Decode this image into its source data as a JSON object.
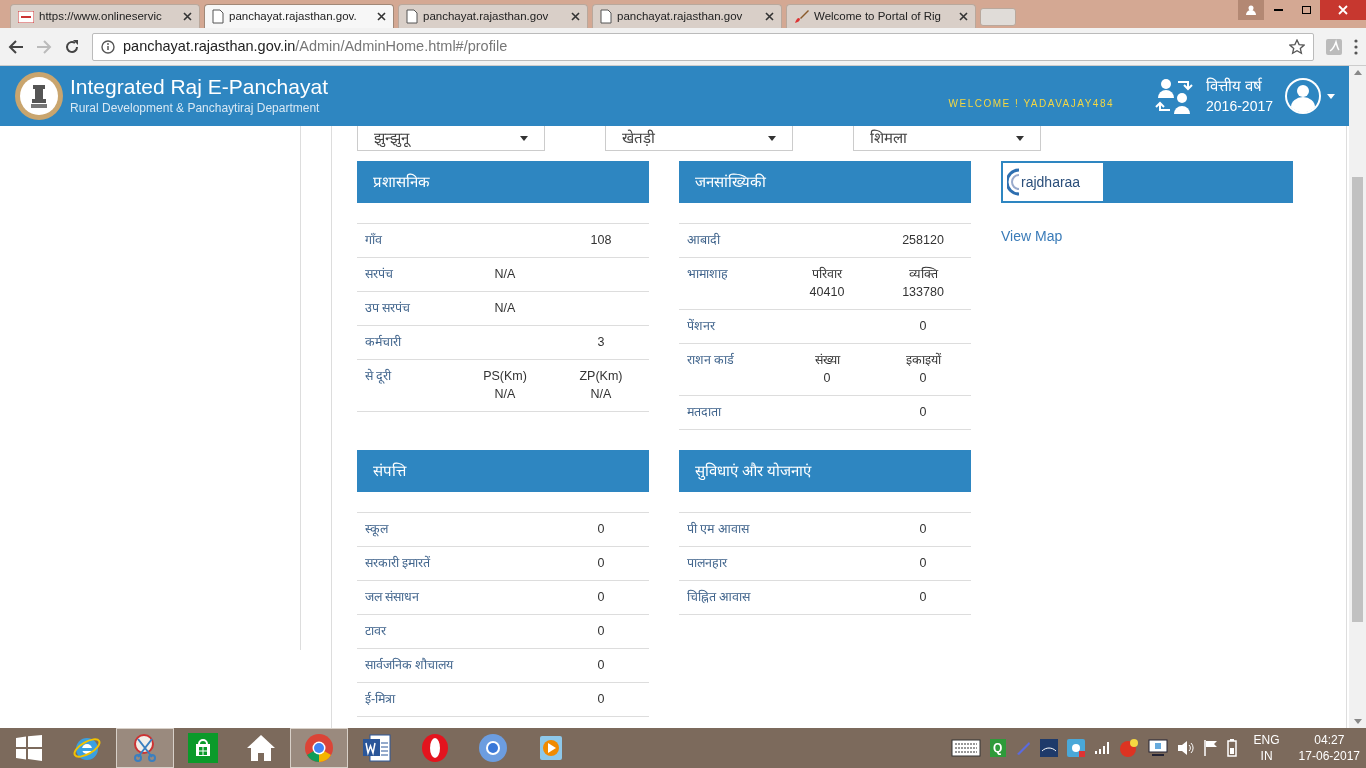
{
  "browser": {
    "tabs": [
      {
        "label": "https://www.onlineservic",
        "selected": false
      },
      {
        "label": "panchayat.rajasthan.gov.",
        "selected": true
      },
      {
        "label": "panchayat.rajasthan.gov",
        "selected": false
      },
      {
        "label": "panchayat.rajasthan.gov",
        "selected": false
      },
      {
        "label": "Welcome to Portal of Rig",
        "selected": false
      }
    ],
    "url_host": "panchayat.rajasthan.gov.in",
    "url_path": "/Admin/AdminHome.html#/profile"
  },
  "header": {
    "title": "Integrated Raj E-Panchayat",
    "subtitle": "Rural Development & Panchaytiraj Department",
    "welcome": "WELCOME ! YADAVAJAY484",
    "year_label": "वित्तीय वर्ष",
    "year": "2016-2017"
  },
  "selects": [
    {
      "value": "झुन्झुनू"
    },
    {
      "value": "खेतड़ी"
    },
    {
      "value": "शिमला"
    }
  ],
  "panels": [
    {
      "title": "प्रशासनिक",
      "rows": [
        {
          "label": "गाँव",
          "right": {
            "value": "108"
          }
        },
        {
          "label": "सरपंच",
          "mid": {
            "value": "N/A"
          }
        },
        {
          "label": "उप सरपंच",
          "mid": {
            "value": "N/A"
          }
        },
        {
          "label": "कर्मचारी",
          "right": {
            "value": "3"
          }
        },
        {
          "label": "से दूरी",
          "mid": {
            "head": "PS(Km)",
            "value": "N/A"
          },
          "right": {
            "head": "ZP(Km)",
            "value": "N/A"
          }
        }
      ]
    },
    {
      "title": "जनसांख्यिकी",
      "rows": [
        {
          "label": "आबादी",
          "right": {
            "value": "258120"
          }
        },
        {
          "label": "भामाशाह",
          "mid": {
            "head": "परिवार",
            "value": "40410"
          },
          "right": {
            "head": "व्यक्ति",
            "value": "133780"
          }
        },
        {
          "label": "पेंशनर",
          "right": {
            "value": "0"
          }
        },
        {
          "label": "राशन कार्ड",
          "mid": {
            "head": "संख्या",
            "value": "0"
          },
          "right": {
            "head": "इकाइयों",
            "value": "0"
          }
        },
        {
          "label": "मतदाता",
          "right": {
            "value": "0"
          }
        }
      ]
    },
    {
      "title": "संपत्ति",
      "rows": [
        {
          "label": "स्कूल",
          "right": {
            "value": "0"
          }
        },
        {
          "label": "सरकारी इमारतें",
          "right": {
            "value": "0"
          }
        },
        {
          "label": "जल संसाधन",
          "right": {
            "value": "0"
          }
        },
        {
          "label": "टावर",
          "right": {
            "value": "0"
          }
        },
        {
          "label": "सार्वजनिक शौचालय",
          "right": {
            "value": "0"
          }
        },
        {
          "label": "ई-मित्रा",
          "right": {
            "value": "0"
          }
        }
      ]
    },
    {
      "title": "सुविधाएं और योजनाएं",
      "rows": [
        {
          "label": "पी एम आवास",
          "right": {
            "value": "0"
          }
        },
        {
          "label": "पालनहार",
          "right": {
            "value": "0"
          }
        },
        {
          "label": "चिह्नित आवास",
          "right": {
            "value": "0"
          }
        }
      ]
    }
  ],
  "map_card": {
    "logo_text": "rajdharaa",
    "link": "View Map"
  },
  "taskbar": {
    "apps": [
      {
        "kind": "start",
        "highlighted": false
      },
      {
        "kind": "ie",
        "highlighted": false
      },
      {
        "kind": "scissors",
        "highlighted": true
      },
      {
        "kind": "store",
        "highlighted": false
      },
      {
        "kind": "home",
        "highlighted": false
      },
      {
        "kind": "chrome",
        "highlighted": true
      },
      {
        "kind": "word",
        "highlighted": false
      },
      {
        "kind": "opera",
        "highlighted": false
      },
      {
        "kind": "chromium",
        "highlighted": false
      },
      {
        "kind": "player",
        "highlighted": false
      }
    ],
    "tray_q": "Q",
    "lang": "ENG",
    "region": "IN",
    "time": "04:27",
    "date": "17-06-2017"
  }
}
